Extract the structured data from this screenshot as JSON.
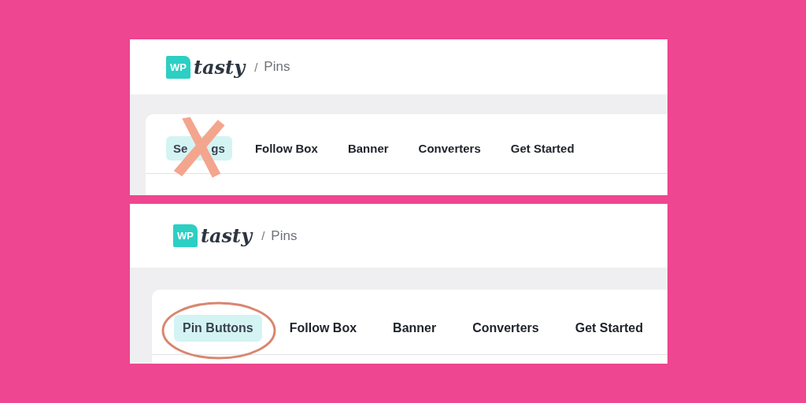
{
  "panels": [
    {
      "logo": {
        "badge": "WP",
        "word": "tasty"
      },
      "separator": "/",
      "breadcrumb": "Pins",
      "annotation": {
        "kind": "cross"
      },
      "tabs": [
        {
          "visible_parts": [
            "Se",
            "gs"
          ],
          "selected": true
        },
        {
          "label": "Follow Box",
          "selected": false
        },
        {
          "label": "Banner",
          "selected": false
        },
        {
          "label": "Converters",
          "selected": false
        },
        {
          "label": "Get Started",
          "selected": false
        }
      ]
    },
    {
      "logo": {
        "badge": "WP",
        "word": "tasty"
      },
      "separator": "/",
      "breadcrumb": "Pins",
      "annotation": {
        "kind": "circle"
      },
      "tabs": [
        {
          "label": "Pin Buttons",
          "selected": true
        },
        {
          "label": "Follow Box",
          "selected": false
        },
        {
          "label": "Banner",
          "selected": false
        },
        {
          "label": "Converters",
          "selected": false
        },
        {
          "label": "Get Started",
          "selected": false
        }
      ]
    }
  ]
}
